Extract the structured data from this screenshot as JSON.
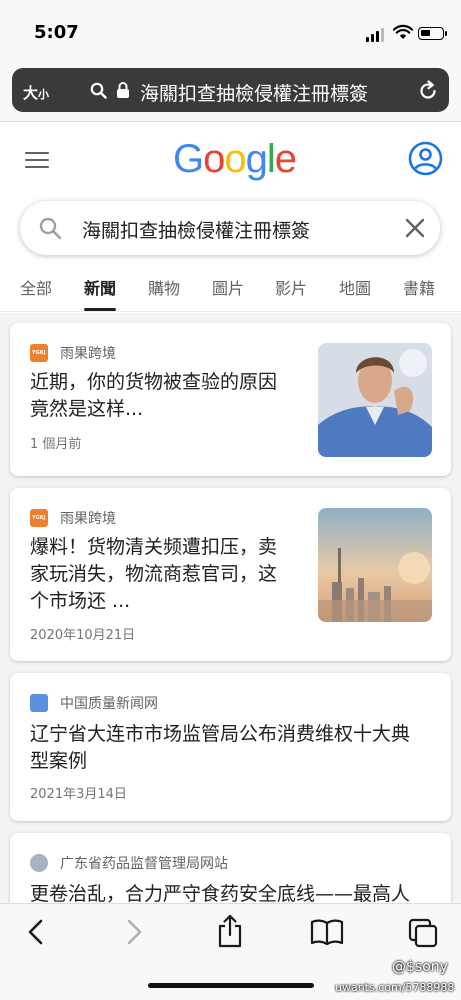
{
  "status_bar": {
    "time": "5:07"
  },
  "address_bar": {
    "text_size_label": "大",
    "text_size_label_small": "小",
    "url_text": "海關扣查抽檢侵權注冊標簽"
  },
  "search": {
    "query": "海關扣查抽檢侵權注冊標簽"
  },
  "tabs": [
    {
      "label": "全部",
      "active": false
    },
    {
      "label": "新聞",
      "active": true
    },
    {
      "label": "購物",
      "active": false
    },
    {
      "label": "圖片",
      "active": false
    },
    {
      "label": "影片",
      "active": false
    },
    {
      "label": "地圖",
      "active": false
    },
    {
      "label": "書籍",
      "active": false
    }
  ],
  "results": [
    {
      "source": "雨果跨境",
      "title_lines": [
        "近期，你的货物被查验的原因",
        "竟然是这样..."
      ],
      "date": "1 個月前",
      "thumbnail": "man-holding-head-photo"
    },
    {
      "source": "雨果跨境",
      "title_lines": [
        "爆料！货物清关频遭扣压，卖",
        "家玩消失，物流商惹官司，这",
        "个市场还 ..."
      ],
      "date": "2020年10月21日",
      "thumbnail": "city-skyline-photo"
    },
    {
      "source": "中国质量新闻网",
      "title_lines": [
        "辽宁省大连市市场监管局公布消费维权十大典",
        "型案例"
      ],
      "date": "2021年3月14日"
    },
    {
      "source": "广东省药品监督管理局网站",
      "title_lines": [
        "更卷治乱，合力严守食药安全底线——最高人"
      ]
    }
  ],
  "watermark": {
    "line1": "@$sony",
    "line2": "uwants.com/5788988"
  },
  "colors": {
    "google_blue": "#4285f4",
    "google_red": "#ea4335",
    "google_yellow": "#fbbc05",
    "google_green": "#34a853",
    "address_bar_bg": "#3a3a3c"
  }
}
